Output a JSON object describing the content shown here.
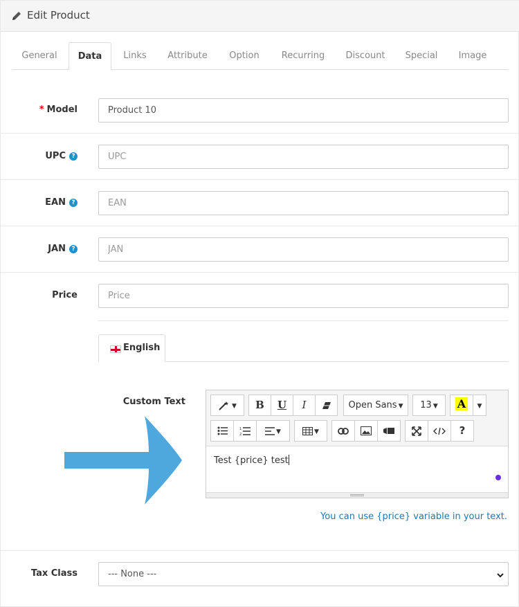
{
  "panel": {
    "title": "Edit Product",
    "icon": "pencil-icon"
  },
  "tabs": [
    {
      "label": "General",
      "active": false
    },
    {
      "label": "Data",
      "active": true
    },
    {
      "label": "Links",
      "active": false
    },
    {
      "label": "Attribute",
      "active": false
    },
    {
      "label": "Option",
      "active": false
    },
    {
      "label": "Recurring",
      "active": false
    },
    {
      "label": "Discount",
      "active": false
    },
    {
      "label": "Special",
      "active": false
    },
    {
      "label": "Image",
      "active": false
    }
  ],
  "fields": {
    "model": {
      "required_mark": "*",
      "label": "Model",
      "value": "Product 10"
    },
    "upc": {
      "label": "UPC",
      "placeholder": "UPC",
      "help": "?"
    },
    "ean": {
      "label": "EAN",
      "placeholder": "EAN",
      "help": "?"
    },
    "jan": {
      "label": "JAN",
      "placeholder": "JAN",
      "help": "?"
    },
    "price": {
      "label": "Price",
      "placeholder": "Price"
    }
  },
  "language_tab": {
    "label": "English",
    "flag": "uk-flag-icon"
  },
  "custom_text": {
    "label": "Custom Text",
    "content": "Test {price} test",
    "hint": "You can use {price} variable in your text."
  },
  "editor_toolbar": {
    "font_name": "Open Sans",
    "font_size": "13",
    "bold": "B",
    "underline": "U",
    "italic": "I",
    "help": "?",
    "highlight": "A",
    "highlight_color": "#ffff00"
  },
  "tax_class": {
    "label": "Tax Class",
    "selected": "--- None ---"
  },
  "colors": {
    "arrow": "#4ea8de",
    "link": "#1a7ab0",
    "required": "#ff0000",
    "help_badge": "#1e91cf",
    "status_dot": "#6a2cf0"
  }
}
